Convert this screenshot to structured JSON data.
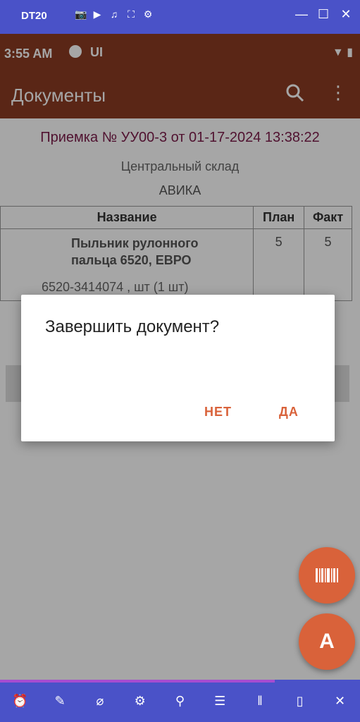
{
  "emulator": {
    "title": "DT20",
    "top_icons": [
      "camera-icon",
      "video-icon",
      "headset-icon",
      "fullscreen-icon",
      "settings-icon"
    ],
    "window_controls": [
      "minimize-icon",
      "maximize-icon",
      "close-icon"
    ],
    "bottom_tools": [
      "clock-icon",
      "mic-off-icon",
      "camera-off-icon",
      "gear-icon",
      "location-icon",
      "keyboard-icon",
      "pause-icon",
      "stop-icon",
      "exit-icon"
    ]
  },
  "status_bar": {
    "time": "3:55 AM",
    "ui_label": "UI"
  },
  "app_bar": {
    "title": "Документы"
  },
  "document": {
    "header": "Приемка № УУ00-3 от 01-17-2024 13:38:22",
    "warehouse": "Центральный склад",
    "counterparty": "АВИКА",
    "columns": [
      "Название",
      "План",
      "Факт"
    ],
    "items": [
      {
        "name_line1": "Пыльник рулонного",
        "name_line2": "пальца 6520, ЕВРО",
        "code": "6520-3414074 , шт (1 шт)",
        "plan": "5",
        "fact": "5"
      }
    ]
  },
  "dialog": {
    "title": "Завершить документ?",
    "no_label": "НЕТ",
    "yes_label": "ДА"
  },
  "fab": {
    "a_label": "A"
  },
  "colors": {
    "primary": "#8a3b22",
    "accent": "#d9623a",
    "header_text": "#7b1c4a",
    "emulator_frame": "#4a52c8"
  }
}
